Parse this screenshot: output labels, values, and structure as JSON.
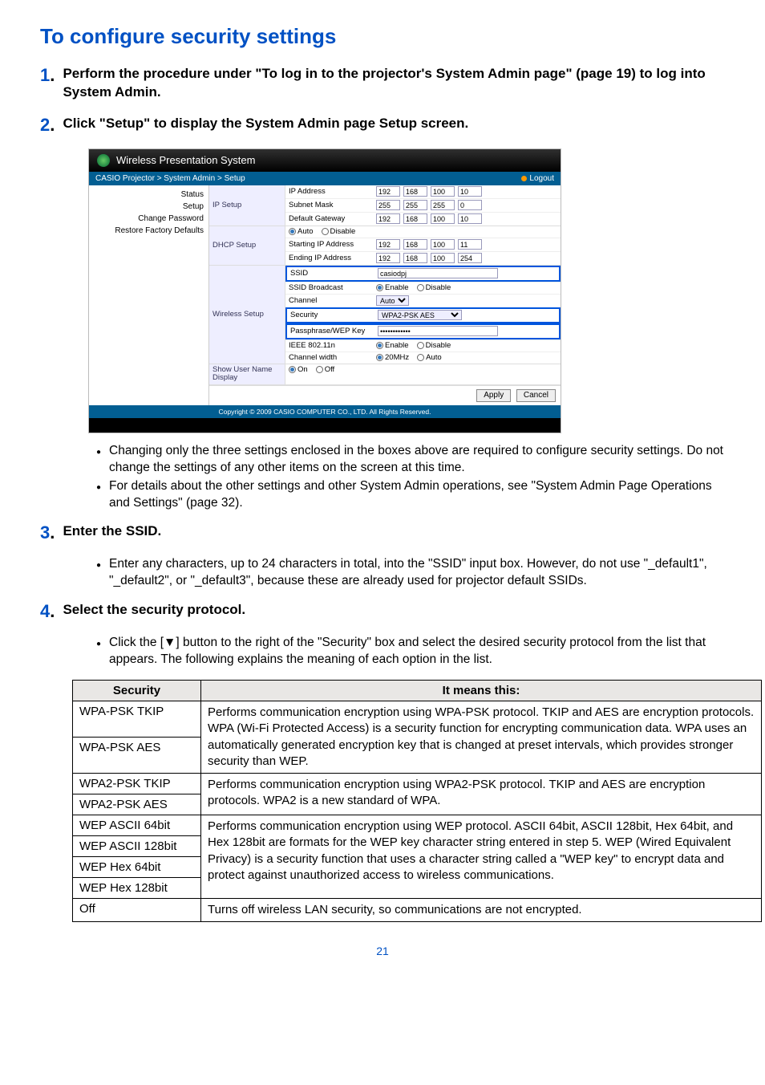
{
  "title": "To configure security settings",
  "steps": {
    "s1": {
      "n": "1",
      "dot": ".",
      "text": "Perform the procedure under \"To log in to the projector's System Admin page\" (page 19) to log into System Admin."
    },
    "s2": {
      "n": "2",
      "dot": ".",
      "text": "Click \"Setup\" to display the System Admin page Setup screen."
    },
    "s3": {
      "n": "3",
      "dot": ".",
      "text": "Enter the SSID."
    },
    "s4": {
      "n": "4",
      "dot": ".",
      "text": "Select the security protocol."
    }
  },
  "bullets": {
    "b2a": "Changing only the three settings enclosed in the boxes above are required to configure security settings. Do not change the settings of any other items on the screen at this time.",
    "b2b": "For details about the other settings and other System Admin operations, see \"System Admin Page Operations and Settings\" (page 32).",
    "b3a": "Enter any characters, up to 24 characters in total, into the \"SSID\" input box. However, do not use \"_default1\", \"_default2\", or \"_default3\", because these are already used for projector default SSIDs.",
    "b4a": "Click the [▼] button to the right of the \"Security\" box and select the desired security protocol from the list that appears. The following explains the meaning of each option in the list."
  },
  "table": {
    "h1": "Security",
    "h2": "It means this:",
    "r1": "WPA-PSK TKIP",
    "r2": "WPA-PSK AES",
    "d12": "Performs communication encryption using WPA-PSK protocol. TKIP and AES are encryption protocols. WPA (Wi-Fi Protected Access) is a security function for encrypting communication data. WPA uses an automatically generated encryption key that is changed at preset intervals, which provides stronger security than WEP.",
    "r3": "WPA2-PSK TKIP",
    "r4": "WPA2-PSK AES",
    "d34": "Performs communication encryption using WPA2-PSK protocol. TKIP and AES are encryption protocols. WPA2 is a new standard of WPA.",
    "r5": "WEP ASCII 64bit",
    "r6": "WEP ASCII 128bit",
    "r7": "WEP Hex 64bit",
    "r8": "WEP Hex 128bit",
    "d58": "Performs communication encryption using WEP protocol. ASCII 64bit, ASCII 128bit, Hex 64bit, and Hex 128bit are formats for the WEP key character string entered in step 5. WEP (Wired Equivalent Privacy) is a security function that uses a character string called a \"WEP key\" to encrypt data and protect against unauthorized access to wireless communications.",
    "r9": "Off",
    "d9": "Turns off wireless LAN security, so communications are not encrypted."
  },
  "panel": {
    "title": "Wireless Presentation System",
    "breadcrumb": "CASIO Projector > System Admin > Setup",
    "logout": "Logout",
    "nav": {
      "a": "Status",
      "b": "Setup",
      "c": "Change Password",
      "d": "Restore Factory Defaults"
    },
    "ip": {
      "sect": "IP Setup",
      "ipaddr": "IP Address",
      "ip": [
        "192",
        "168",
        "100",
        "10"
      ],
      "subnet": "Subnet Mask",
      "sm": [
        "255",
        "255",
        "255",
        "0"
      ],
      "gateway": "Default Gateway",
      "gw": [
        "192",
        "168",
        "100",
        "10"
      ]
    },
    "dhcp": {
      "sect": "DHCP Setup",
      "auto": "Auto",
      "disable": "Disable",
      "start": "Starting IP Address",
      "sip": [
        "192",
        "168",
        "100",
        "11"
      ],
      "end": "Ending IP Address",
      "eip": [
        "192",
        "168",
        "100",
        "254"
      ]
    },
    "wireless": {
      "sect": "Wireless Setup",
      "ssid": "SSID",
      "ssidv": "casiodpj",
      "bcast": "SSID Broadcast",
      "enable": "Enable",
      "disable": "Disable",
      "channel": "Channel",
      "chv": "Auto",
      "security": "Security",
      "secv": "WPA2-PSK AES",
      "pass": "Passphrase/WEP Key",
      "passv": "••••••••••••",
      "ieee": "IEEE 802.11n",
      "cwidth": "Channel width",
      "cw20": "20MHz",
      "cwauto": "Auto"
    },
    "show": {
      "sect": "Show User Name Display",
      "on": "On",
      "off": "Off"
    },
    "apply": "Apply",
    "cancel": "Cancel",
    "copyright": "Copyright © 2009 CASIO COMPUTER CO., LTD. All Rights Reserved."
  },
  "pagenum": "21"
}
